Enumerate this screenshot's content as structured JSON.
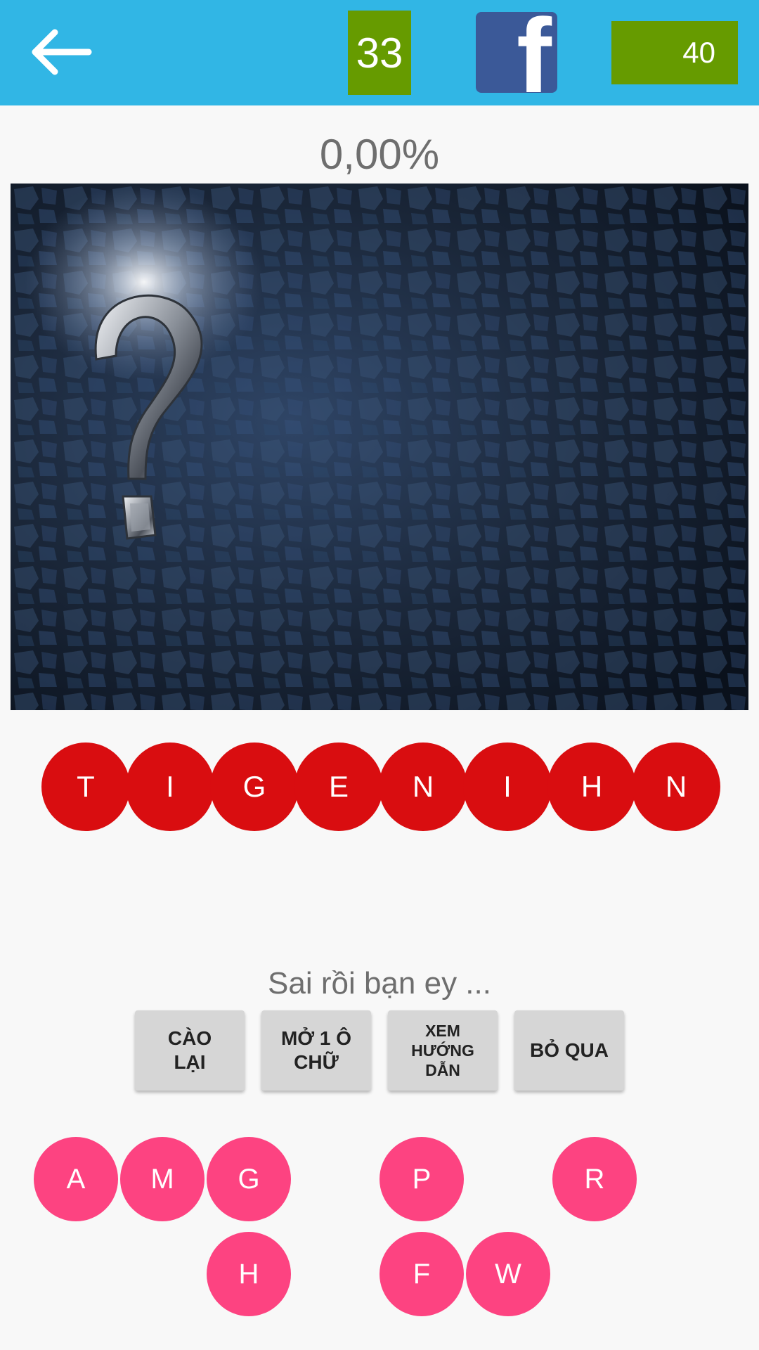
{
  "header": {
    "back_icon": "arrow-left-icon",
    "level": "33",
    "facebook_icon": "facebook-icon",
    "facebook_glyph": "f",
    "coins": "40"
  },
  "progress": {
    "percent_text": "0,00%"
  },
  "image": {
    "icon": "question-mark-image"
  },
  "answer": {
    "letters": [
      "T",
      "I",
      "G",
      "E",
      "N",
      "I",
      "H",
      "N"
    ]
  },
  "status": {
    "message": "Sai rồi bạn ey ..."
  },
  "actions": {
    "redo_label": "CÀO\nLẠI",
    "reveal_label": "MỞ 1 Ô\nCHỮ",
    "guide_label": "XEM\nHƯỚNG\nDẪN",
    "skip_label": "BỎ QUA"
  },
  "keyboard": {
    "keys": [
      "A",
      "M",
      "G",
      "P",
      "R",
      "H",
      "F",
      "W"
    ]
  },
  "colors": {
    "topbar": "#31b6e5",
    "level_box": "#669b00",
    "facebook": "#3b5998",
    "answer_tile": "#d90d10",
    "key_tile": "#fd4381",
    "action_button": "#d6d6d6"
  }
}
